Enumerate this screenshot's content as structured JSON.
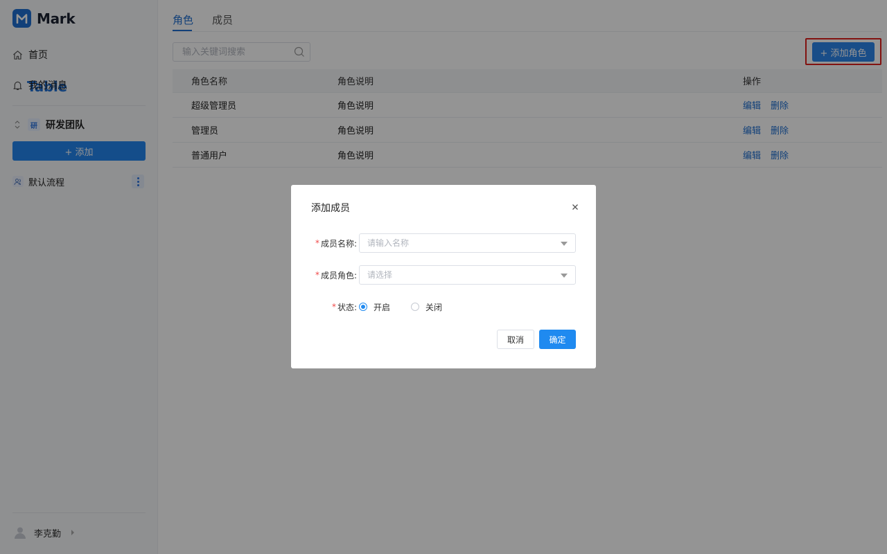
{
  "app": {
    "logo_primary": "Mark",
    "logo_accent": "Table",
    "brand_color": "#1f6fd1"
  },
  "sidebar": {
    "home_label": "首页",
    "messages_label": "我的消息",
    "team": {
      "badge": "研",
      "name": "研发团队"
    },
    "add_label": "+ 添加",
    "flow_label": "默认流程",
    "user_name": "李克勤"
  },
  "tabs": [
    {
      "label": "角色",
      "active": true
    },
    {
      "label": "成员",
      "active": false
    }
  ],
  "toolbar": {
    "search_placeholder": "输入关键词搜索",
    "add_role_label": "+ 添加角色"
  },
  "table": {
    "headers": [
      "角色名称",
      "角色说明",
      "操作"
    ],
    "action_edit": "编辑",
    "action_delete": "删除",
    "rows": [
      {
        "name": "超级管理员",
        "desc": "角色说明"
      },
      {
        "name": "管理员",
        "desc": "角色说明"
      },
      {
        "name": "普通用户",
        "desc": "角色说明"
      }
    ]
  },
  "dialog": {
    "title": "添加成员",
    "required_mark": "*",
    "name_label": "成员名称:",
    "name_placeholder": "请输入名称",
    "role_label": "成员角色:",
    "role_placeholder": "请选择",
    "status_label": "状态:",
    "status_on": "开启",
    "status_off": "关闭",
    "status_value": "开启",
    "cancel_label": "取消",
    "confirm_label": "确定"
  }
}
